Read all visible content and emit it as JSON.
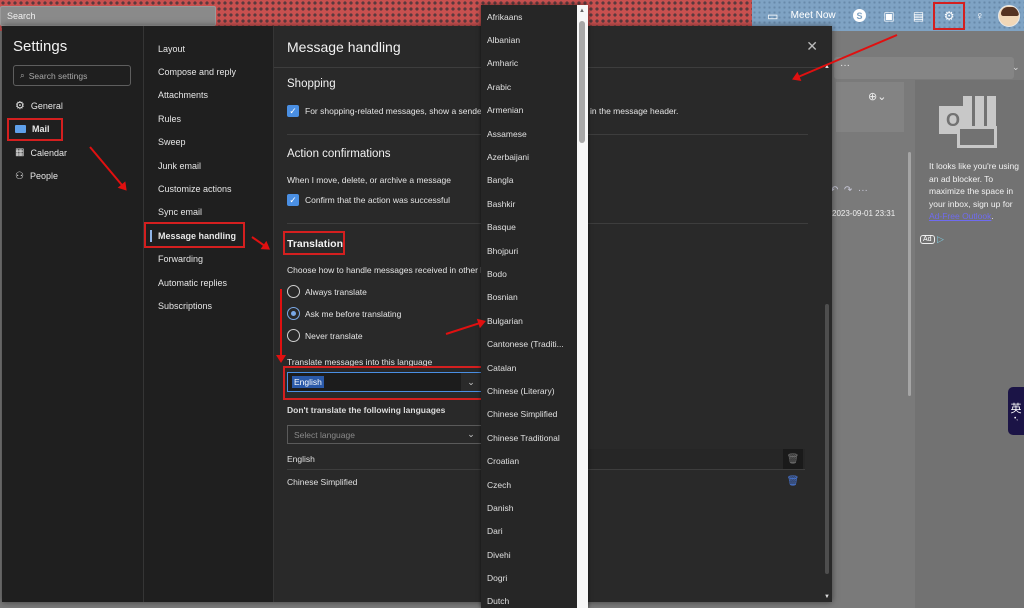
{
  "topbar": {
    "search_placeholder": "Search",
    "meet_now_label": "Meet Now",
    "icons": [
      "video-icon",
      "skype-icon",
      "office-icon",
      "calendar-check-icon",
      "gear-icon",
      "lightbulb-icon",
      "avatar"
    ]
  },
  "settings": {
    "title": "Settings",
    "search_placeholder": "Search settings",
    "categories": [
      {
        "label": "General",
        "icon": "gear-icon"
      },
      {
        "label": "Mail",
        "icon": "mail-icon",
        "active": true
      },
      {
        "label": "Calendar",
        "icon": "calendar-icon"
      },
      {
        "label": "People",
        "icon": "people-icon"
      }
    ],
    "mail_pages": [
      {
        "label": "Layout"
      },
      {
        "label": "Compose and reply"
      },
      {
        "label": "Attachments"
      },
      {
        "label": "Rules"
      },
      {
        "label": "Sweep"
      },
      {
        "label": "Junk email"
      },
      {
        "label": "Customize actions"
      },
      {
        "label": "Sync email"
      },
      {
        "label": "Message handling",
        "active": true
      },
      {
        "label": "Forwarding"
      },
      {
        "label": "Automatic replies"
      },
      {
        "label": "Subscriptions"
      }
    ]
  },
  "panel": {
    "title": "Message handling",
    "shopping": {
      "heading": "Shopping",
      "checkbox_label": "For shopping-related messages, show a sender",
      "checkbox_label_tail": "in the message header.",
      "checked": true
    },
    "action_confirmations": {
      "heading": "Action confirmations",
      "description": "When I move, delete, or archive a message",
      "checkbox_label": "Confirm that the action was successful",
      "checked": true
    },
    "translation": {
      "heading": "Translation",
      "description": "Choose how to handle messages received in other languages",
      "options": [
        {
          "label": "Always translate",
          "selected": false
        },
        {
          "label": "Ask me before translating",
          "selected": true
        },
        {
          "label": "Never translate",
          "selected": false
        }
      ],
      "translate_into_label": "Translate messages into this language",
      "translate_into_value": "English",
      "dont_translate_label": "Don't translate the following languages",
      "select_language_placeholder": "Select language",
      "excluded_languages": [
        "English",
        "Chinese Simplified"
      ]
    }
  },
  "language_dropdown": {
    "options": [
      "Afrikaans",
      "Albanian",
      "Amharic",
      "Arabic",
      "Armenian",
      "Assamese",
      "Azerbaijani",
      "Bangla",
      "Bashkir",
      "Basque",
      "Bhojpuri",
      "Bodo",
      "Bosnian",
      "Bulgarian",
      "Cantonese (Traditi...",
      "Catalan",
      "Chinese (Literary)",
      "Chinese Simplified",
      "Chinese Traditional",
      "Croatian",
      "Czech",
      "Danish",
      "Dari",
      "Divehi",
      "Dogri",
      "Dutch"
    ]
  },
  "background_app": {
    "timestamp": "2023-09-01 23:31",
    "ad_text": "It looks like you're using an ad blocker. To maximize the space in your inbox, sign up for",
    "ad_link": "Ad-Free Outlook",
    "ad_badge": "Ad",
    "ime_label": "英"
  },
  "colors": {
    "accent": "#4a8fe3",
    "annotation": "#d41f1f",
    "panel_bg": "#292929",
    "nav_bg": "#1f1f1f"
  }
}
